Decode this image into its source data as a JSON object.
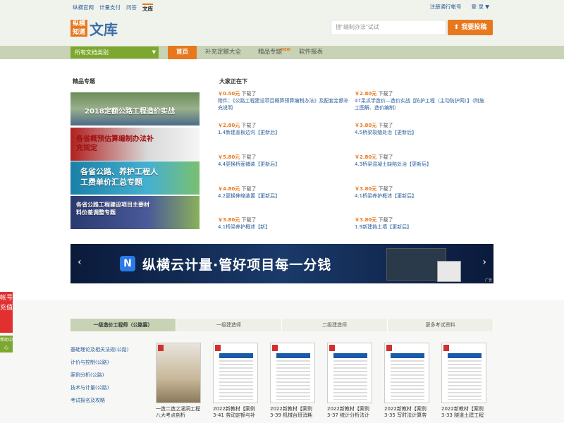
{
  "top": {
    "links": [
      "纵横官网",
      "计量支付",
      "问答",
      "文库"
    ],
    "active_link": "文库",
    "register": "注册通行帐号",
    "login": "登 录 ▼"
  },
  "header": {
    "logo_box": "纵横知道",
    "logo_text": "文库",
    "search_placeholder": "搜\"编制办法\"试试",
    "upload_label": "我要投稿"
  },
  "nav": {
    "category": "所有文档类别",
    "tabs": [
      "首页",
      "补充定额大全",
      "精品专题",
      "软件报表"
    ],
    "new_badge": "NEW"
  },
  "featured": {
    "title": "精品专题",
    "banners": [
      "2018定额公路工程造价实战",
      "各省概预估算编制办法补充规定",
      "各省公路、养护工程人工费单价汇总专题",
      "各省公路工程建设项目主要材料价差调整专题"
    ]
  },
  "downloading": {
    "title": "大家正在下",
    "items": [
      {
        "price": "￥0.50元",
        "dl": "下载了",
        "name": "附件：《公路工程建设项目概算预算编制办法》及配套定额补充说明"
      },
      {
        "price": "￥2.80元",
        "dl": "下载了",
        "name": "47呆瓜学造价—造价实战【防护工程（主动防护网）】（附施工图解、造价编制）"
      },
      {
        "price": "￥2.80元",
        "dl": "下载了",
        "name": "1.4新建盖板边沟【更新后】"
      },
      {
        "price": "￥3.80元",
        "dl": "下载了",
        "name": "4.5桥梁裂缝处治【更新后】"
      },
      {
        "price": "￥5.80元",
        "dl": "下载了",
        "name": "4.4更换桥面铺装【更新后】"
      },
      {
        "price": "￥2.80元",
        "dl": "下载了",
        "name": "4.3桥梁混凝土缺陷处治【更新后】"
      },
      {
        "price": "￥4.80元",
        "dl": "下载了",
        "name": "4.2更换伸缩装置【更新后】"
      },
      {
        "price": "￥3.80元",
        "dl": "下载了",
        "name": "4.1桥梁养护概述【更新后】"
      },
      {
        "price": "￥3.80元",
        "dl": "下载了",
        "name": "4.1桥梁养护概述【新】"
      },
      {
        "price": "￥3.80元",
        "dl": "下载了",
        "name": "1.9新建挡土墙【更新后】"
      }
    ]
  },
  "ad": {
    "logo": "N",
    "text": "纵横云计量·管好项目每一分钱",
    "prev": "‹",
    "next": "›",
    "tag": "广告"
  },
  "lower": {
    "tabs": [
      "一级造价工程师（公路篇）",
      "一级建造师",
      "二级建造师",
      "更多考试资料"
    ],
    "categories": [
      "基础理论及相关法规(公路)",
      "计价与控制(公路)",
      "案例分析(公路)",
      "技术与计量(公路)",
      "考试报名及攻略"
    ],
    "books": [
      "一造二造之涵洞工程八大考点剖析",
      "2022新教材【案例3-41 劳动定额与补充定额】",
      "2022新教材【案例3-39 机械台班消耗定额】",
      "2022新教材【案例3-37 统计分析法计算】",
      "2022新教材【案例3-35 写时法计算劳动定额】",
      "2022新教材【案例3-33 隧道土建工程概算】"
    ]
  },
  "side": {
    "charge": "帐号充值",
    "help": "帮助中心"
  }
}
